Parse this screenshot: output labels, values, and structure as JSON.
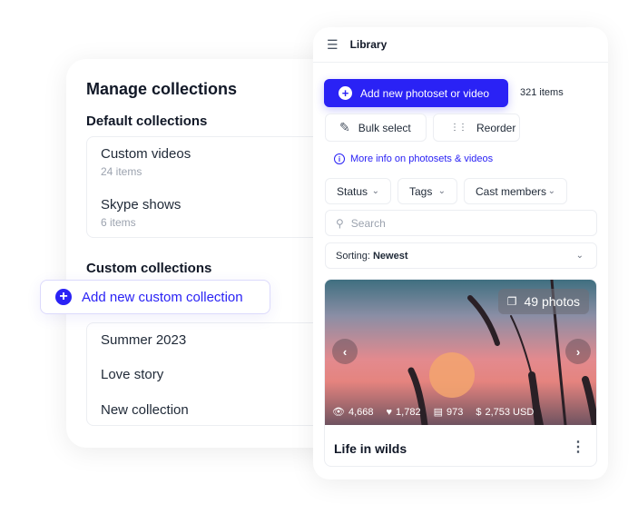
{
  "manage": {
    "title": "Manage collections",
    "default_heading": "Default collections",
    "default_items": [
      {
        "name": "Custom videos",
        "count": "24 items"
      },
      {
        "name": "Skype shows",
        "count": "6 items"
      }
    ],
    "custom_heading": "Custom collections",
    "add_custom_label": "Add new custom collection",
    "custom_items": [
      "Summer 2023",
      "Love story",
      "New collection"
    ]
  },
  "library": {
    "title": "Library",
    "add_label": "Add new photoset or video",
    "item_count": "321 items",
    "bulk_label": "Bulk select",
    "reorder_label": "Reorder",
    "info_link": "More info on photosets & videos",
    "filters": [
      "Status",
      "Tags",
      "Cast members"
    ],
    "search_placeholder": "Search",
    "sorting_label": "Sorting:",
    "sorting_value": "Newest",
    "card": {
      "badge": "49 photos",
      "views": "4,668",
      "likes": "1,782",
      "comments": "973",
      "earnings": "2,753 USD",
      "title": "Life in wilds"
    }
  },
  "colors": {
    "accent": "#2a22f5"
  }
}
